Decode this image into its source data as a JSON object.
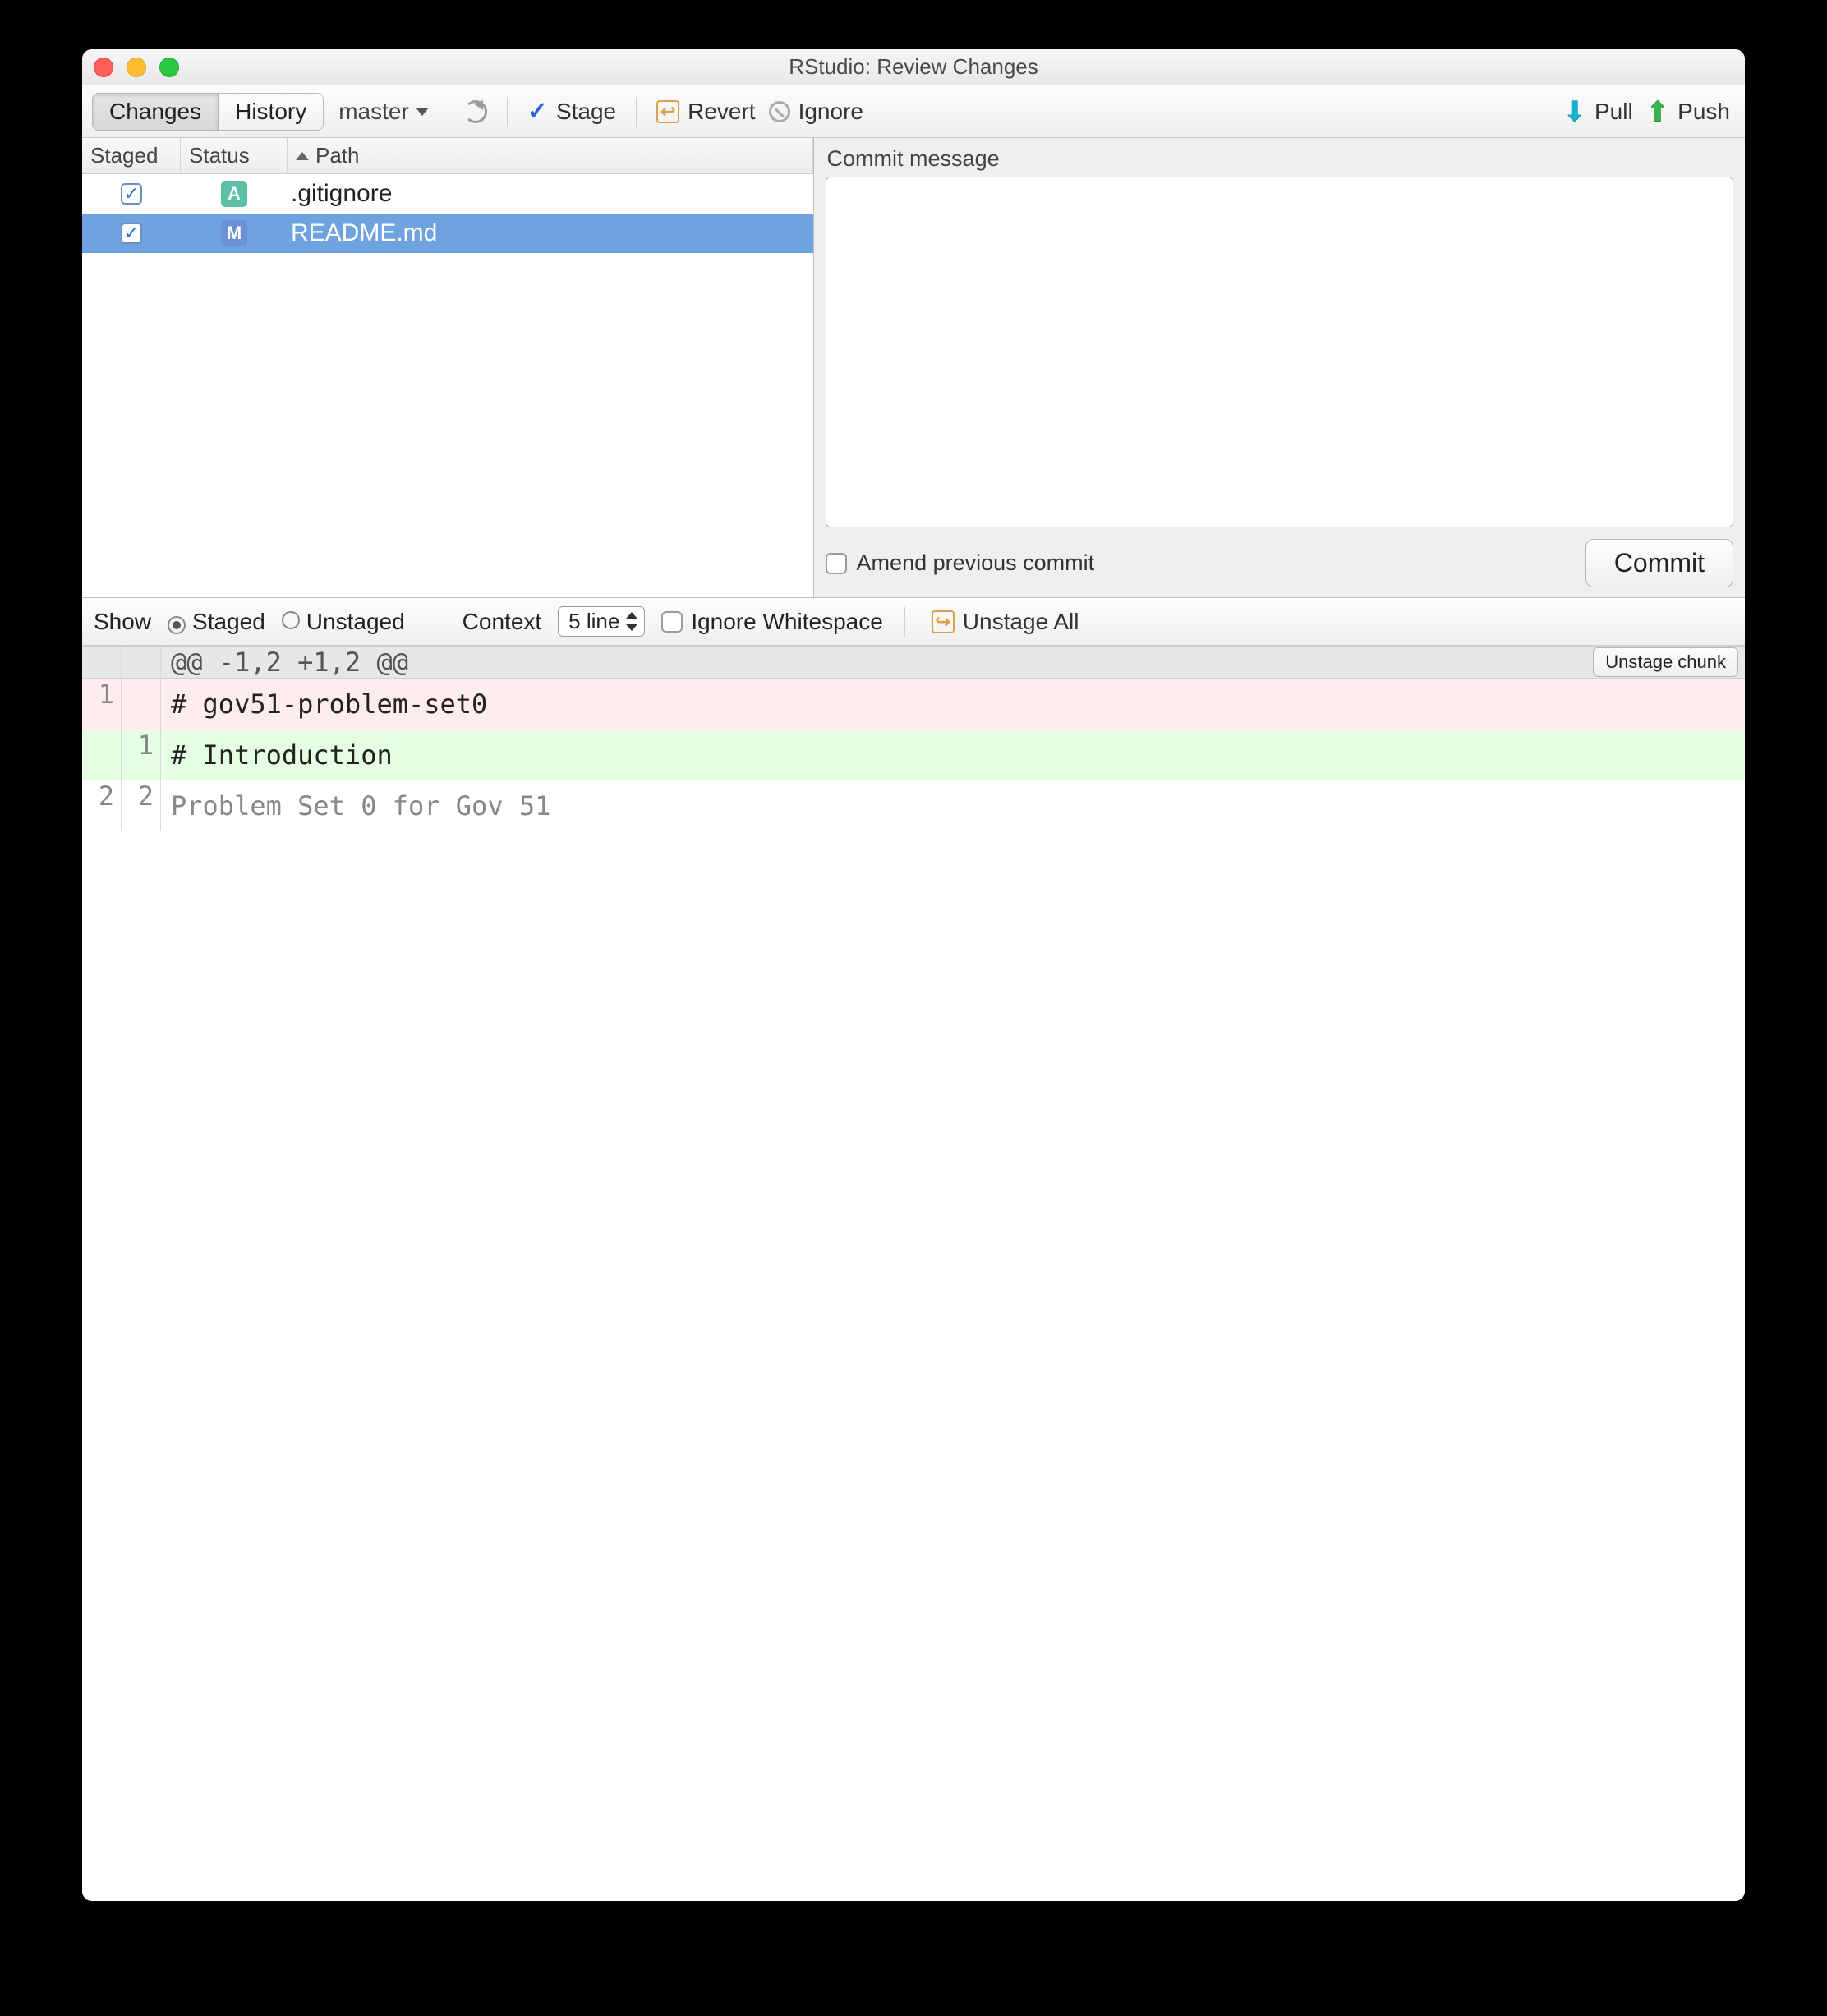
{
  "window": {
    "title": "RStudio: Review Changes"
  },
  "toolbar": {
    "changes_label": "Changes",
    "history_label": "History",
    "branch": "master",
    "stage_label": "Stage",
    "revert_label": "Revert",
    "ignore_label": "Ignore",
    "pull_label": "Pull",
    "push_label": "Push"
  },
  "filelist": {
    "headers": {
      "staged": "Staged",
      "status": "Status",
      "path": "Path"
    },
    "rows": [
      {
        "staged": true,
        "status": "A",
        "path": ".gitignore",
        "selected": false
      },
      {
        "staged": true,
        "status": "M",
        "path": "README.md",
        "selected": true
      }
    ]
  },
  "commit": {
    "message_label": "Commit message",
    "amend_label": "Amend previous commit",
    "commit_button": "Commit"
  },
  "diffbar": {
    "show_label": "Show",
    "staged_label": "Staged",
    "unstaged_label": "Unstaged",
    "context_label": "Context",
    "context_value": "5 line",
    "ignore_ws_label": "Ignore Whitespace",
    "unstage_all_label": "Unstage All"
  },
  "diff": {
    "hunk_header": "@@ -1,2 +1,2 @@",
    "unstage_chunk": "Unstage chunk",
    "lines": [
      {
        "type": "del",
        "old": "1",
        "new": "",
        "text": "# gov51-problem-set0"
      },
      {
        "type": "add",
        "old": "",
        "new": "1",
        "text": "# Introduction"
      },
      {
        "type": "ctx",
        "old": "2",
        "new": "2",
        "text": "Problem Set 0 for Gov 51"
      }
    ]
  }
}
